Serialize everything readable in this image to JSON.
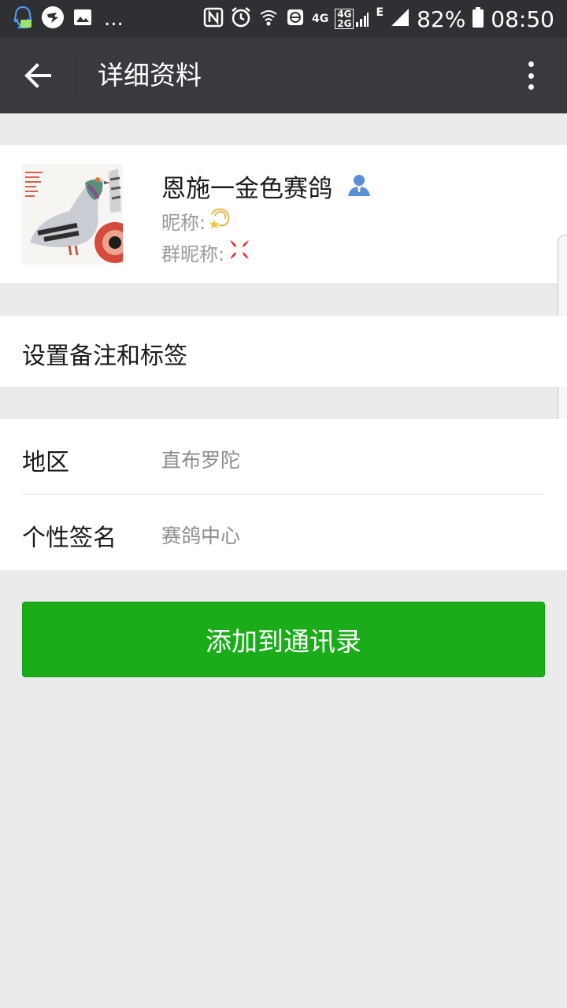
{
  "status_bar": {
    "battery": "82%",
    "time": "08:50",
    "net_4g": "4G",
    "net_4g2g_top": "4G",
    "net_4g2g_bottom": "2G",
    "net_e": "E",
    "overflow": "..."
  },
  "app_bar": {
    "title": "详细资料"
  },
  "profile": {
    "name": "恩施一金色赛鸽",
    "nickname_label": "昵称:",
    "group_nickname_label": "群昵称:"
  },
  "remark": {
    "label": "设置备注和标签"
  },
  "info": {
    "rows": [
      {
        "label": "地区",
        "value": "直布罗陀"
      },
      {
        "label": "个性签名",
        "value": "赛鸽中心"
      }
    ]
  },
  "add_button": {
    "label": "添加到通讯录"
  },
  "colors": {
    "app_bar": "#393a3f",
    "status_bar": "#2e3034",
    "accent_green": "#1aad19",
    "background": "#ebebeb"
  }
}
